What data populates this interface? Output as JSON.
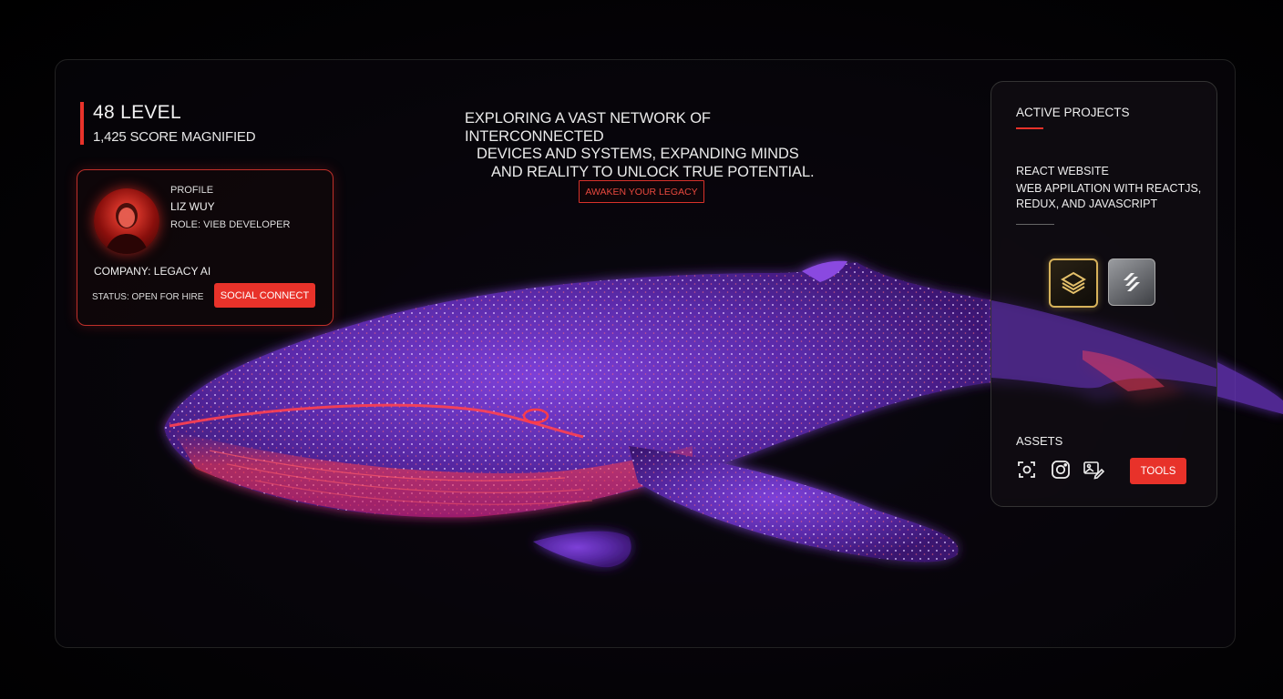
{
  "stats": {
    "level": "48 LEVEL",
    "score": "1,425 SCORE MAGNIFIED"
  },
  "profile": {
    "title": "PROFILE",
    "name": "LIZ WUY",
    "role": "ROLE: VIEB DEVELOPER",
    "company": "COMPANY: LEGACY AI",
    "status": "STATUS: OPEN FOR HIRE",
    "social_button": "SOCIAL CONNECT"
  },
  "hero": {
    "line1": "EXPLORING A VAST NETWORK OF INTERCONNECTED",
    "line2": "DEVICES AND SYSTEMS, EXPANDING MINDS",
    "line3": "AND REALITY TO UNLOCK TRUE POTENTIAL.",
    "cta": "AWAKEN YOUR LEGACY"
  },
  "panel": {
    "title": "ACTIVE PROJECTS",
    "project_name": "REACT WEBSITE",
    "project_desc": "WEB APPILATION WITH REACTJS, REDUX, AND JAVASCRIPT",
    "apps": [
      "layers-gold-icon",
      "stack-silver-icon"
    ],
    "assets_title": "ASSETS",
    "asset_icons": [
      "scan-icon",
      "instagram-icon",
      "image-edit-icon"
    ],
    "tools_button": "TOOLS"
  },
  "colors": {
    "accent": "#e8322a",
    "background": "#000000",
    "whale_purple": "#7a3ed8",
    "whale_red": "#ff3a3a"
  }
}
